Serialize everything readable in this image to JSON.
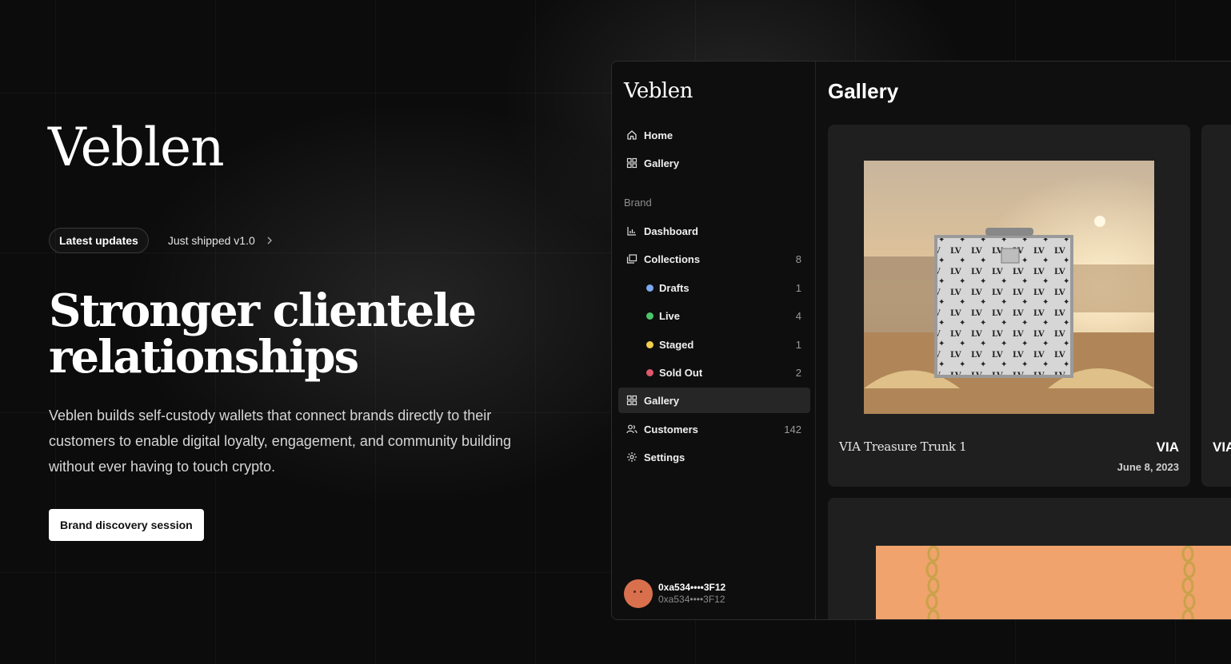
{
  "hero": {
    "logo": "Veblen",
    "updates_pill": "Latest updates",
    "updates_link": "Just shipped v1.0",
    "headline": "Stronger clientele relationships",
    "subcopy": "Veblen builds self-custody wallets that connect brands directly to their customers to enable digital loyalty, engagement, and community building without ever having to touch crypto.",
    "cta": "Brand discovery session"
  },
  "app": {
    "logo": "Veblen",
    "nav_top": [
      {
        "label": "Home",
        "icon": "home-icon"
      },
      {
        "label": "Gallery",
        "icon": "gallery-icon"
      }
    ],
    "section_label": "Brand",
    "nav_brand": [
      {
        "label": "Dashboard",
        "icon": "bar-chart-icon",
        "count": ""
      },
      {
        "label": "Collections",
        "icon": "collections-icon",
        "count": "8"
      },
      {
        "label": "Drafts",
        "dot_color": "#7ba7f0",
        "count": "1"
      },
      {
        "label": "Live",
        "dot_color": "#4cc56a",
        "count": "4"
      },
      {
        "label": "Staged",
        "dot_color": "#f2cf4a",
        "count": "1"
      },
      {
        "label": "Sold Out",
        "dot_color": "#e0576b",
        "count": "2"
      },
      {
        "label": "Gallery",
        "icon": "gallery-icon",
        "count": "",
        "active": true
      },
      {
        "label": "Customers",
        "icon": "users-icon",
        "count": "142"
      },
      {
        "label": "Settings",
        "icon": "gear-icon",
        "count": ""
      }
    ],
    "wallet": {
      "address": "0xa534••••3F12",
      "address_sub": "0xa534••••3F12"
    },
    "main": {
      "title": "Gallery",
      "cards": [
        {
          "title": "VIA Treasure Trunk 1",
          "brand": "VIA",
          "date": "June 8, 2023"
        },
        {
          "brand": "VIA"
        }
      ]
    }
  },
  "colors": {
    "background": "#0c0c0c",
    "avatar": "#d9704d",
    "card": "#1f1f1f"
  }
}
